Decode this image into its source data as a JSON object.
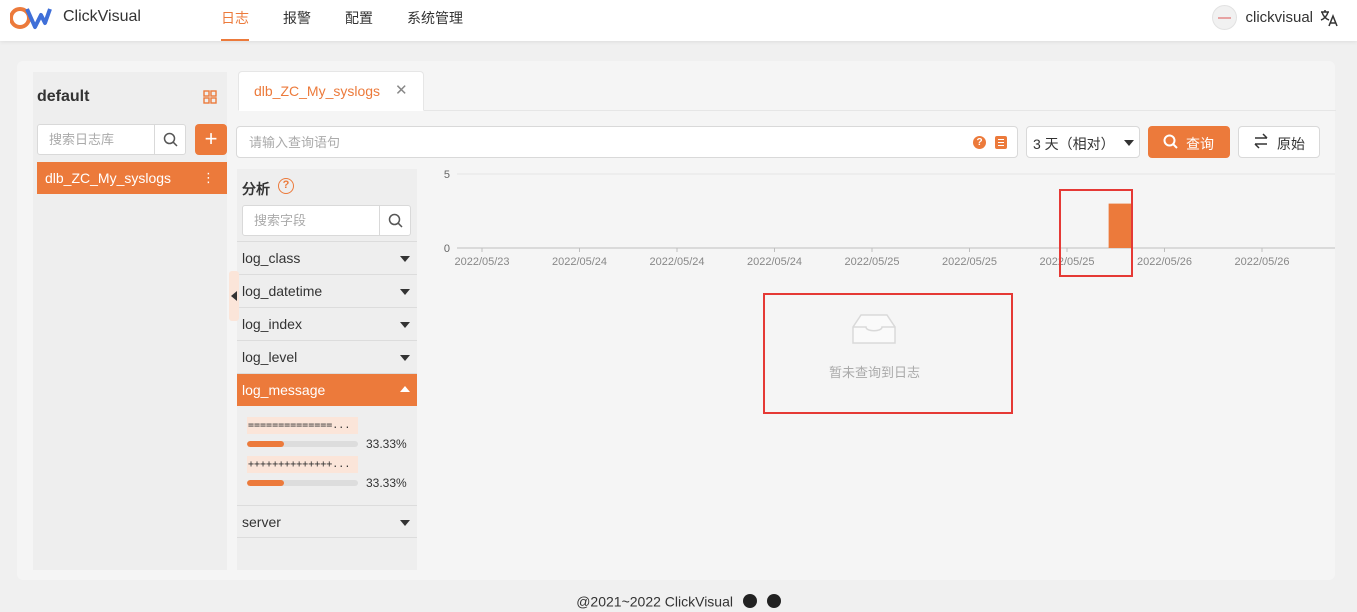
{
  "app": {
    "brand": "ClickVisual"
  },
  "nav": [
    {
      "label": "日志",
      "active": true
    },
    {
      "label": "报警"
    },
    {
      "label": "配置"
    },
    {
      "label": "系统管理"
    }
  ],
  "user": {
    "name": "clickvisual"
  },
  "colors": {
    "accent": "#ec7a3b",
    "highlight": "#e53935"
  },
  "database_panel": {
    "title": "default",
    "search_placeholder": "搜索日志库",
    "add_label": "+",
    "tables": [
      {
        "name": "dlb_ZC_My_syslogs",
        "more": "⋮",
        "selected": true
      }
    ]
  },
  "tab": {
    "label": "dlb_ZC_My_syslogs",
    "close": "✕"
  },
  "query": {
    "placeholder": "请输入查询语句",
    "help_icon": "?",
    "time_range": "3 天（相对）",
    "search_button": "查询",
    "raw_button": "原始"
  },
  "field_panel": {
    "title": "分析",
    "help_icon": "?",
    "search_placeholder": "搜索字段",
    "fields": [
      {
        "name": "log_class"
      },
      {
        "name": "log_datetime"
      },
      {
        "name": "log_index"
      },
      {
        "name": "log_level"
      },
      {
        "name": "log_message",
        "expanded": true
      },
      {
        "name": "server"
      }
    ],
    "expanded_values": [
      {
        "text": "==============...",
        "percent": "33.33%",
        "fraction": 0.3333
      },
      {
        "text": "++++++++++++++...",
        "percent": "33.33%",
        "fraction": 0.3333
      }
    ]
  },
  "chart_data": {
    "type": "bar",
    "ylim": [
      0,
      5
    ],
    "y_ticks": [
      "5",
      "0"
    ],
    "x_ticks": [
      "2022/05/23",
      "2022/05/24",
      "2022/05/24",
      "2022/05/24",
      "2022/05/25",
      "2022/05/25",
      "2022/05/25",
      "2022/05/26",
      "2022/05/26"
    ],
    "bars": [
      {
        "tick_index": 6.55,
        "value": 3
      }
    ],
    "grid": true
  },
  "empty_state": {
    "text": "暂未查询到日志"
  },
  "footer": {
    "text": "@2021~2022 ClickVisual"
  }
}
